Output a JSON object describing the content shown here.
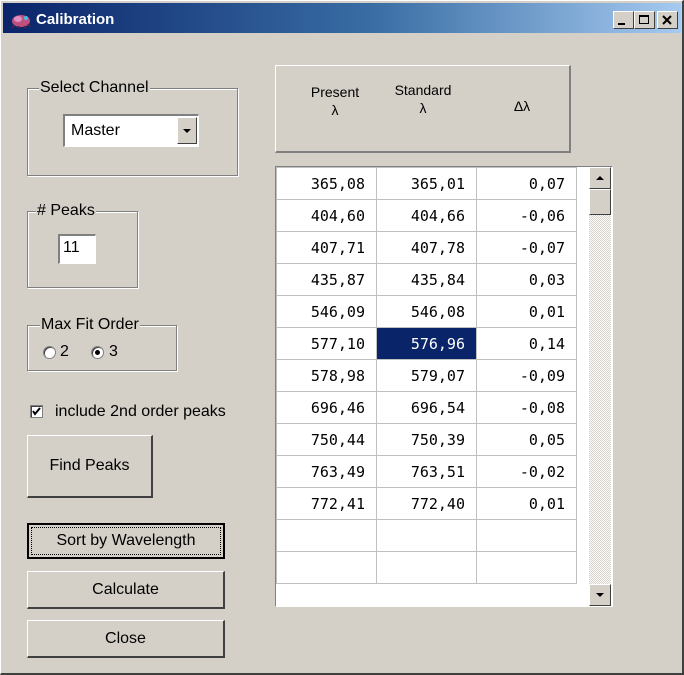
{
  "window": {
    "title": "Calibration"
  },
  "select_channel": {
    "label": "Select Channel",
    "value": "Master"
  },
  "peaks": {
    "label": "# Peaks",
    "value": "11"
  },
  "fit_order": {
    "label": "Max Fit Order",
    "options": [
      "2",
      "3"
    ],
    "selected": "3"
  },
  "include_2nd_order": {
    "label": "include 2nd order peaks",
    "checked": true
  },
  "buttons": {
    "find_peaks": "Find Peaks",
    "sort": "Sort by Wavelength",
    "calculate": "Calculate",
    "close": "Close"
  },
  "table": {
    "headers": [
      {
        "top": "Present",
        "bottom": "λ"
      },
      {
        "top": "Standard",
        "bottom": "λ"
      },
      {
        "top": "",
        "bottom": "Δλ"
      }
    ],
    "rows": [
      [
        "365,08",
        "365,01",
        "0,07"
      ],
      [
        "404,60",
        "404,66",
        "-0,06"
      ],
      [
        "407,71",
        "407,78",
        "-0,07"
      ],
      [
        "435,87",
        "435,84",
        "0,03"
      ],
      [
        "546,09",
        "546,08",
        "0,01"
      ],
      [
        "577,10",
        "576,96",
        "0,14"
      ],
      [
        "578,98",
        "579,07",
        "-0,09"
      ],
      [
        "696,46",
        "696,54",
        "-0,08"
      ],
      [
        "750,44",
        "750,39",
        "0,05"
      ],
      [
        "763,49",
        "763,51",
        "-0,02"
      ],
      [
        "772,41",
        "772,40",
        "0,01"
      ],
      [
        "",
        "",
        ""
      ],
      [
        "",
        "",
        ""
      ]
    ],
    "selected_cell": "576,96"
  },
  "colors": {
    "title_start": "#0a246a",
    "title_end": "#a6caf0",
    "face": "#d4d0c8",
    "selection": "#0a246a"
  }
}
